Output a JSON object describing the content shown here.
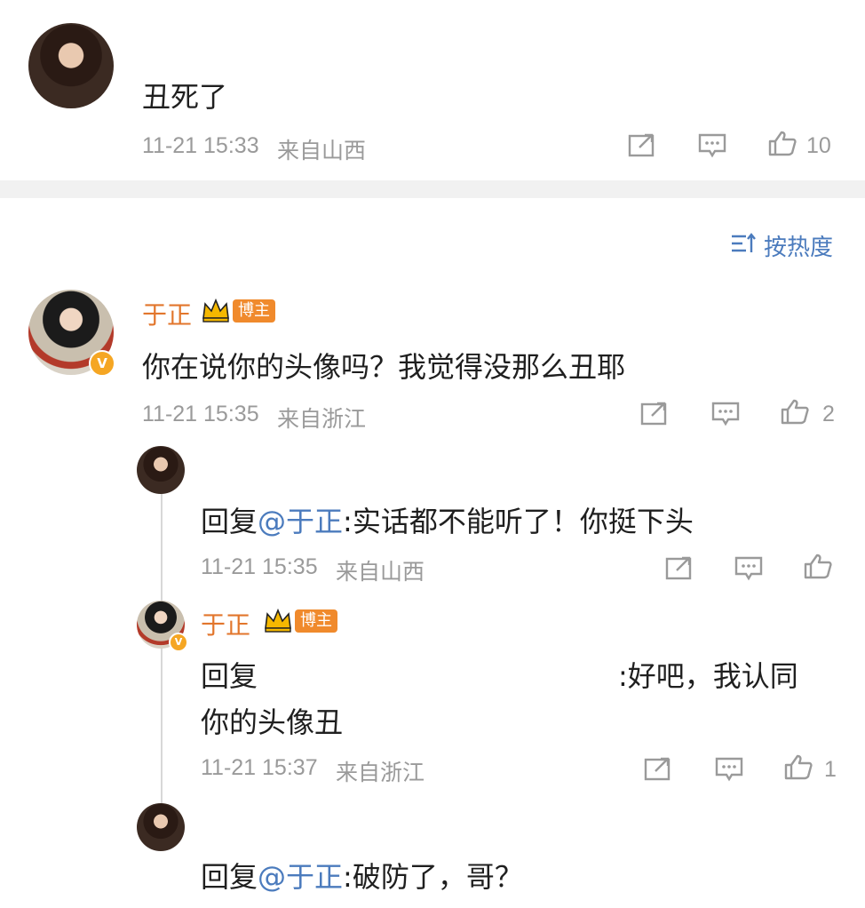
{
  "top_comment": {
    "text": "丑死了",
    "time": "11-21 15:33",
    "location": "来自山西",
    "likes": "10"
  },
  "sort": {
    "label": "按热度",
    "icon": "sort-icon"
  },
  "main_comment": {
    "author": "于正",
    "badge": "博主",
    "verified": "V",
    "text": "你在说你的头像吗？我觉得没那么丑耶",
    "time": "11-21 15:35",
    "location": "来自浙江",
    "likes": "2"
  },
  "replies": [
    {
      "prefix": "回复",
      "mention": "@于正",
      "text": ":实话都不能听了！你挺下头",
      "time": "11-21 15:35",
      "location": "来自山西"
    },
    {
      "author": "于正",
      "badge": "博主",
      "verified": "V",
      "prefix": "回复",
      "text": ":好吧，我认同",
      "text2": "你的头像丑",
      "time": "11-21 15:37",
      "location": "来自浙江",
      "likes": "1"
    },
    {
      "prefix": "回复",
      "mention": "@于正",
      "text": ":破防了，哥？"
    }
  ],
  "colors": {
    "accent_name": "#e2762c",
    "mention": "#4b7bbd",
    "meta": "#9a9a9a"
  }
}
